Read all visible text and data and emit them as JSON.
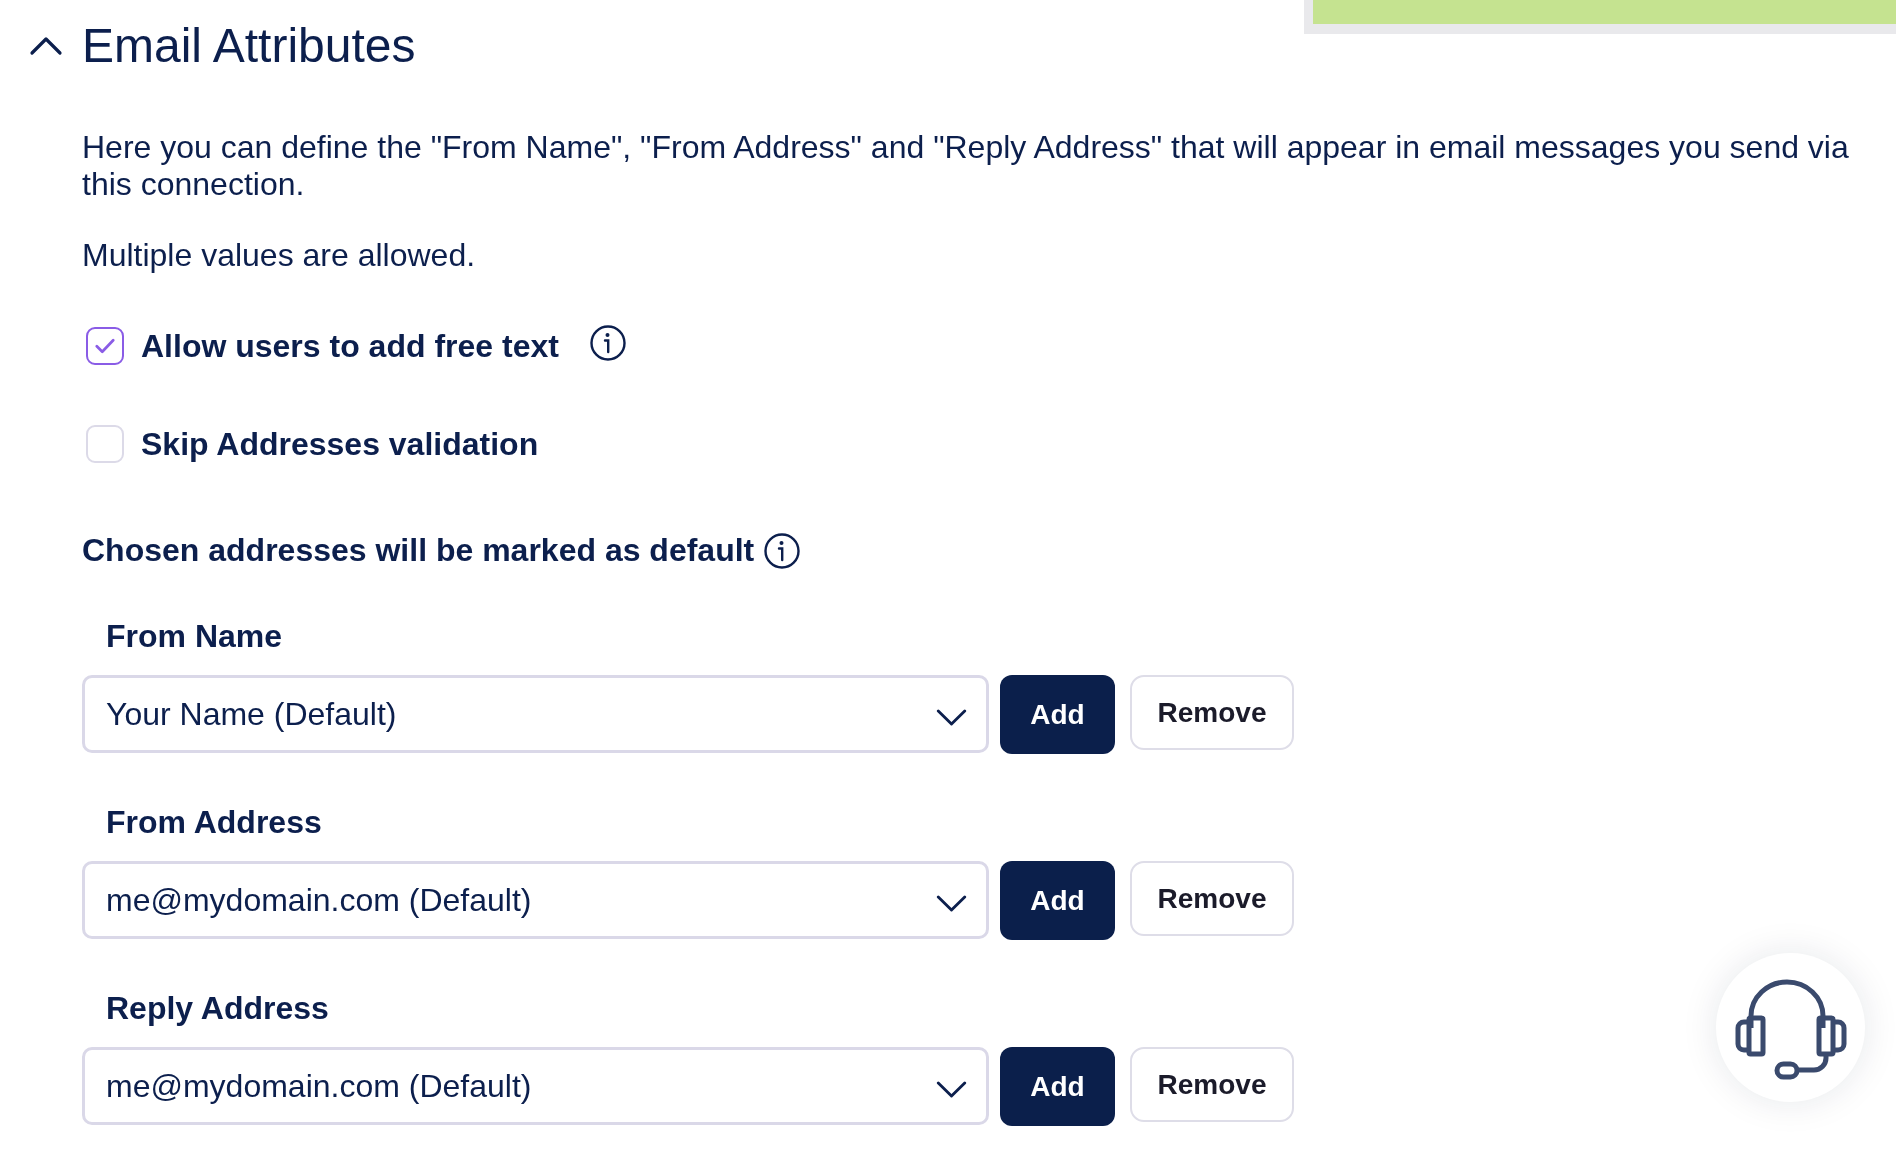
{
  "section": {
    "title": "Email Attributes",
    "expanded": true
  },
  "description": "Here you can define the \"From Name\", \"From Address\" and \"Reply Address\" that will appear in email messages you send via this connection.",
  "note": "Multiple values are allowed.",
  "options": [
    {
      "label": "Allow users to add free text",
      "checked": true,
      "info": true
    },
    {
      "label": "Skip Addresses validation",
      "checked": false,
      "info": false
    }
  ],
  "defaults": {
    "heading": "Chosen addresses will be marked as default",
    "info": true
  },
  "fields": [
    {
      "label": "From Name",
      "value": "Your Name (Default)",
      "add_label": "Add",
      "remove_label": "Remove"
    },
    {
      "label": "From Address",
      "value": "me@mydomain.com (Default)",
      "add_label": "Add",
      "remove_label": "Remove"
    },
    {
      "label": "Reply Address",
      "value": "me@mydomain.com (Default)",
      "add_label": "Add",
      "remove_label": "Remove"
    }
  ]
}
